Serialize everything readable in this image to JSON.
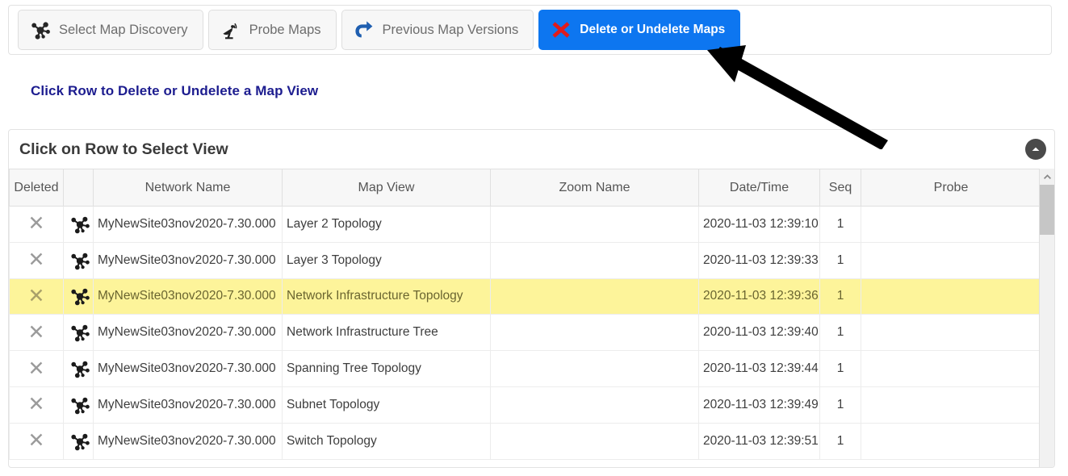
{
  "tabs": [
    {
      "label": "Select Map Discovery",
      "icon": "network-hub-icon",
      "active": false
    },
    {
      "label": "Probe Maps",
      "icon": "satellite-dish-icon",
      "active": false
    },
    {
      "label": "Previous Map Versions",
      "icon": "redo-arrow-icon",
      "active": false
    },
    {
      "label": "Delete or Undelete Maps",
      "icon": "red-x-icon",
      "active": true
    }
  ],
  "subheading": "Click Row to Delete or Undelete a Map View",
  "panel": {
    "title": "Click on Row to Select View",
    "collapse_icon": "chevron-up-icon"
  },
  "table": {
    "columns": [
      "Deleted",
      "",
      "Network Name",
      "Map View",
      "Zoom Name",
      "Date/Time",
      "Seq",
      "Probe"
    ],
    "rows": [
      {
        "deleted": "✕",
        "icon": "network-hub-icon",
        "network_name": "MyNewSite03nov2020-7.30.000",
        "map_view": "Layer 2 Topology",
        "zoom_name": "",
        "datetime": "2020-11-03 12:39:10",
        "seq": "1",
        "probe": "",
        "selected": false
      },
      {
        "deleted": "✕",
        "icon": "network-hub-icon",
        "network_name": "MyNewSite03nov2020-7.30.000",
        "map_view": "Layer 3 Topology",
        "zoom_name": "",
        "datetime": "2020-11-03 12:39:33",
        "seq": "1",
        "probe": "",
        "selected": false
      },
      {
        "deleted": "✕",
        "icon": "network-hub-icon",
        "network_name": "MyNewSite03nov2020-7.30.000",
        "map_view": "Network Infrastructure Topology",
        "zoom_name": "",
        "datetime": "2020-11-03 12:39:36",
        "seq": "1",
        "probe": "",
        "selected": true
      },
      {
        "deleted": "✕",
        "icon": "network-hub-icon",
        "network_name": "MyNewSite03nov2020-7.30.000",
        "map_view": "Network Infrastructure Tree",
        "zoom_name": "",
        "datetime": "2020-11-03 12:39:40",
        "seq": "1",
        "probe": "",
        "selected": false
      },
      {
        "deleted": "✕",
        "icon": "network-hub-icon",
        "network_name": "MyNewSite03nov2020-7.30.000",
        "map_view": "Spanning Tree Topology",
        "zoom_name": "",
        "datetime": "2020-11-03 12:39:44",
        "seq": "1",
        "probe": "",
        "selected": false
      },
      {
        "deleted": "✕",
        "icon": "network-hub-icon",
        "network_name": "MyNewSite03nov2020-7.30.000",
        "map_view": "Subnet Topology",
        "zoom_name": "",
        "datetime": "2020-11-03 12:39:49",
        "seq": "1",
        "probe": "",
        "selected": false
      },
      {
        "deleted": "✕",
        "icon": "network-hub-icon",
        "network_name": "MyNewSite03nov2020-7.30.000",
        "map_view": "Switch Topology",
        "zoom_name": "",
        "datetime": "2020-11-03 12:39:51",
        "seq": "1",
        "probe": "",
        "selected": false
      }
    ]
  },
  "scrollbar": {
    "up_icon": "chevron-up-icon"
  },
  "annotation": {
    "arrow": "pointer-arrow-up-left",
    "color": "#000000"
  },
  "colors": {
    "active_tab": "#0d76f0",
    "heading": "#1c1c8f",
    "selected_row": "#fdf49a",
    "delete_x": "#e01b1b"
  }
}
